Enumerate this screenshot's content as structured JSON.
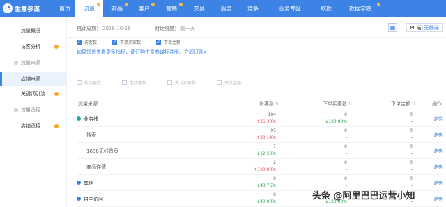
{
  "brand": {
    "name": "生意参谋"
  },
  "nav": [
    {
      "label": "首页",
      "dot": false
    },
    {
      "label": "流量",
      "dot": true,
      "active": true
    },
    {
      "label": "商品",
      "dot": true
    },
    {
      "label": "客户",
      "dot": true
    },
    {
      "label": "营销",
      "dot": true
    },
    {
      "label": "交易",
      "dot": false
    },
    {
      "label": "服务",
      "dot": false
    },
    {
      "label": "竞争",
      "dot": false
    },
    {
      "label": "业务专区",
      "dot": false
    },
    {
      "label": "取数",
      "dot": false
    },
    {
      "label": "数据学院",
      "dot": true
    }
  ],
  "sidebar": [
    {
      "label": "流量概况",
      "sub": false
    },
    {
      "label": "访客分析",
      "sub": false,
      "dot": true
    },
    {
      "label": "流量来源",
      "sub": true
    },
    {
      "label": "店铺来源",
      "sub": false,
      "active": true
    },
    {
      "label": "关键词引流",
      "sub": false,
      "dot": true
    },
    {
      "label": "流量承接",
      "sub": true
    },
    {
      "label": "店铺承接",
      "sub": false,
      "dot": true
    }
  ],
  "toolbar": {
    "period_label": "统计周期：",
    "period_value": "2018-10-16",
    "compare_label": "对比维度：",
    "compare_value": "前一天",
    "device_pc": "PC端",
    "device_wireless": "无线端"
  },
  "metrics_row1": [
    "访客数",
    "下单买家数",
    "下单金额"
  ],
  "hint": "如果您想查看更多指标，请订购生意参谋标准版。立即订购>",
  "metrics_row2": [
    "新访客数",
    "老访客数",
    "支付买家数",
    "支付金额"
  ],
  "table": {
    "headers": {
      "source": "流量来源",
      "visitors": "访客数",
      "buyers": "下单买家数",
      "amount": "下单金额",
      "action": "操作"
    },
    "rows": [
      {
        "name": "业务线",
        "level": 1,
        "dot": "#22a3a0",
        "visitors": "104",
        "visitors_chg": "25.30%",
        "visitors_dir": "up",
        "buyers": "0",
        "buyers_chg": "100.00%",
        "buyers_dir": "down",
        "amount": "0",
        "amount_chg": "-",
        "action": "趋势"
      },
      {
        "name": "搜索",
        "level": 2,
        "visitors": "95",
        "visitors_chg": "30.14%",
        "visitors_dir": "up",
        "buyers": "0",
        "buyers_chg": "-",
        "buyers_dir": "none",
        "amount": "0",
        "amount_chg": "-",
        "action": "趋势"
      },
      {
        "name": "1688无线首页",
        "level": 2,
        "visitors": "7",
        "visitors_chg": "12.50%",
        "visitors_dir": "down",
        "buyers": "0",
        "buyers_chg": "-",
        "buyers_dir": "none",
        "amount": "0",
        "amount_chg": "-",
        "action": "趋势"
      },
      {
        "name": "商品详情",
        "level": 2,
        "visitors": "2",
        "visitors_chg": "100.00%",
        "visitors_dir": "up",
        "buyers": "0",
        "buyers_chg": "-",
        "buyers_dir": "none",
        "amount": "0",
        "amount_chg": "-",
        "action": "趋势"
      },
      {
        "name": "其他",
        "level": 1,
        "dot": "#3d83e6",
        "visitors": "9",
        "visitors_chg": "43.75%",
        "visitors_dir": "down",
        "buyers": "0",
        "buyers_chg": "-",
        "buyers_dir": "none",
        "amount": "0",
        "amount_chg": "-",
        "action": "趋势"
      },
      {
        "name": "自主访问",
        "level": 1,
        "dot": "#3d83e6",
        "visitors": "6",
        "visitors_chg": "40.00%",
        "visitors_dir": "down",
        "buyers": "0",
        "buyers_chg": "100.00%",
        "buyers_dir": "down",
        "amount": "0",
        "amount_chg": "-",
        "action": "趋势"
      }
    ]
  },
  "watermark": "头条 @阿里巴巴运营小知",
  "colors": {
    "accent": "#3d83e6",
    "up": "#e5474e",
    "down": "#22a350",
    "dot": "#f6a623"
  }
}
